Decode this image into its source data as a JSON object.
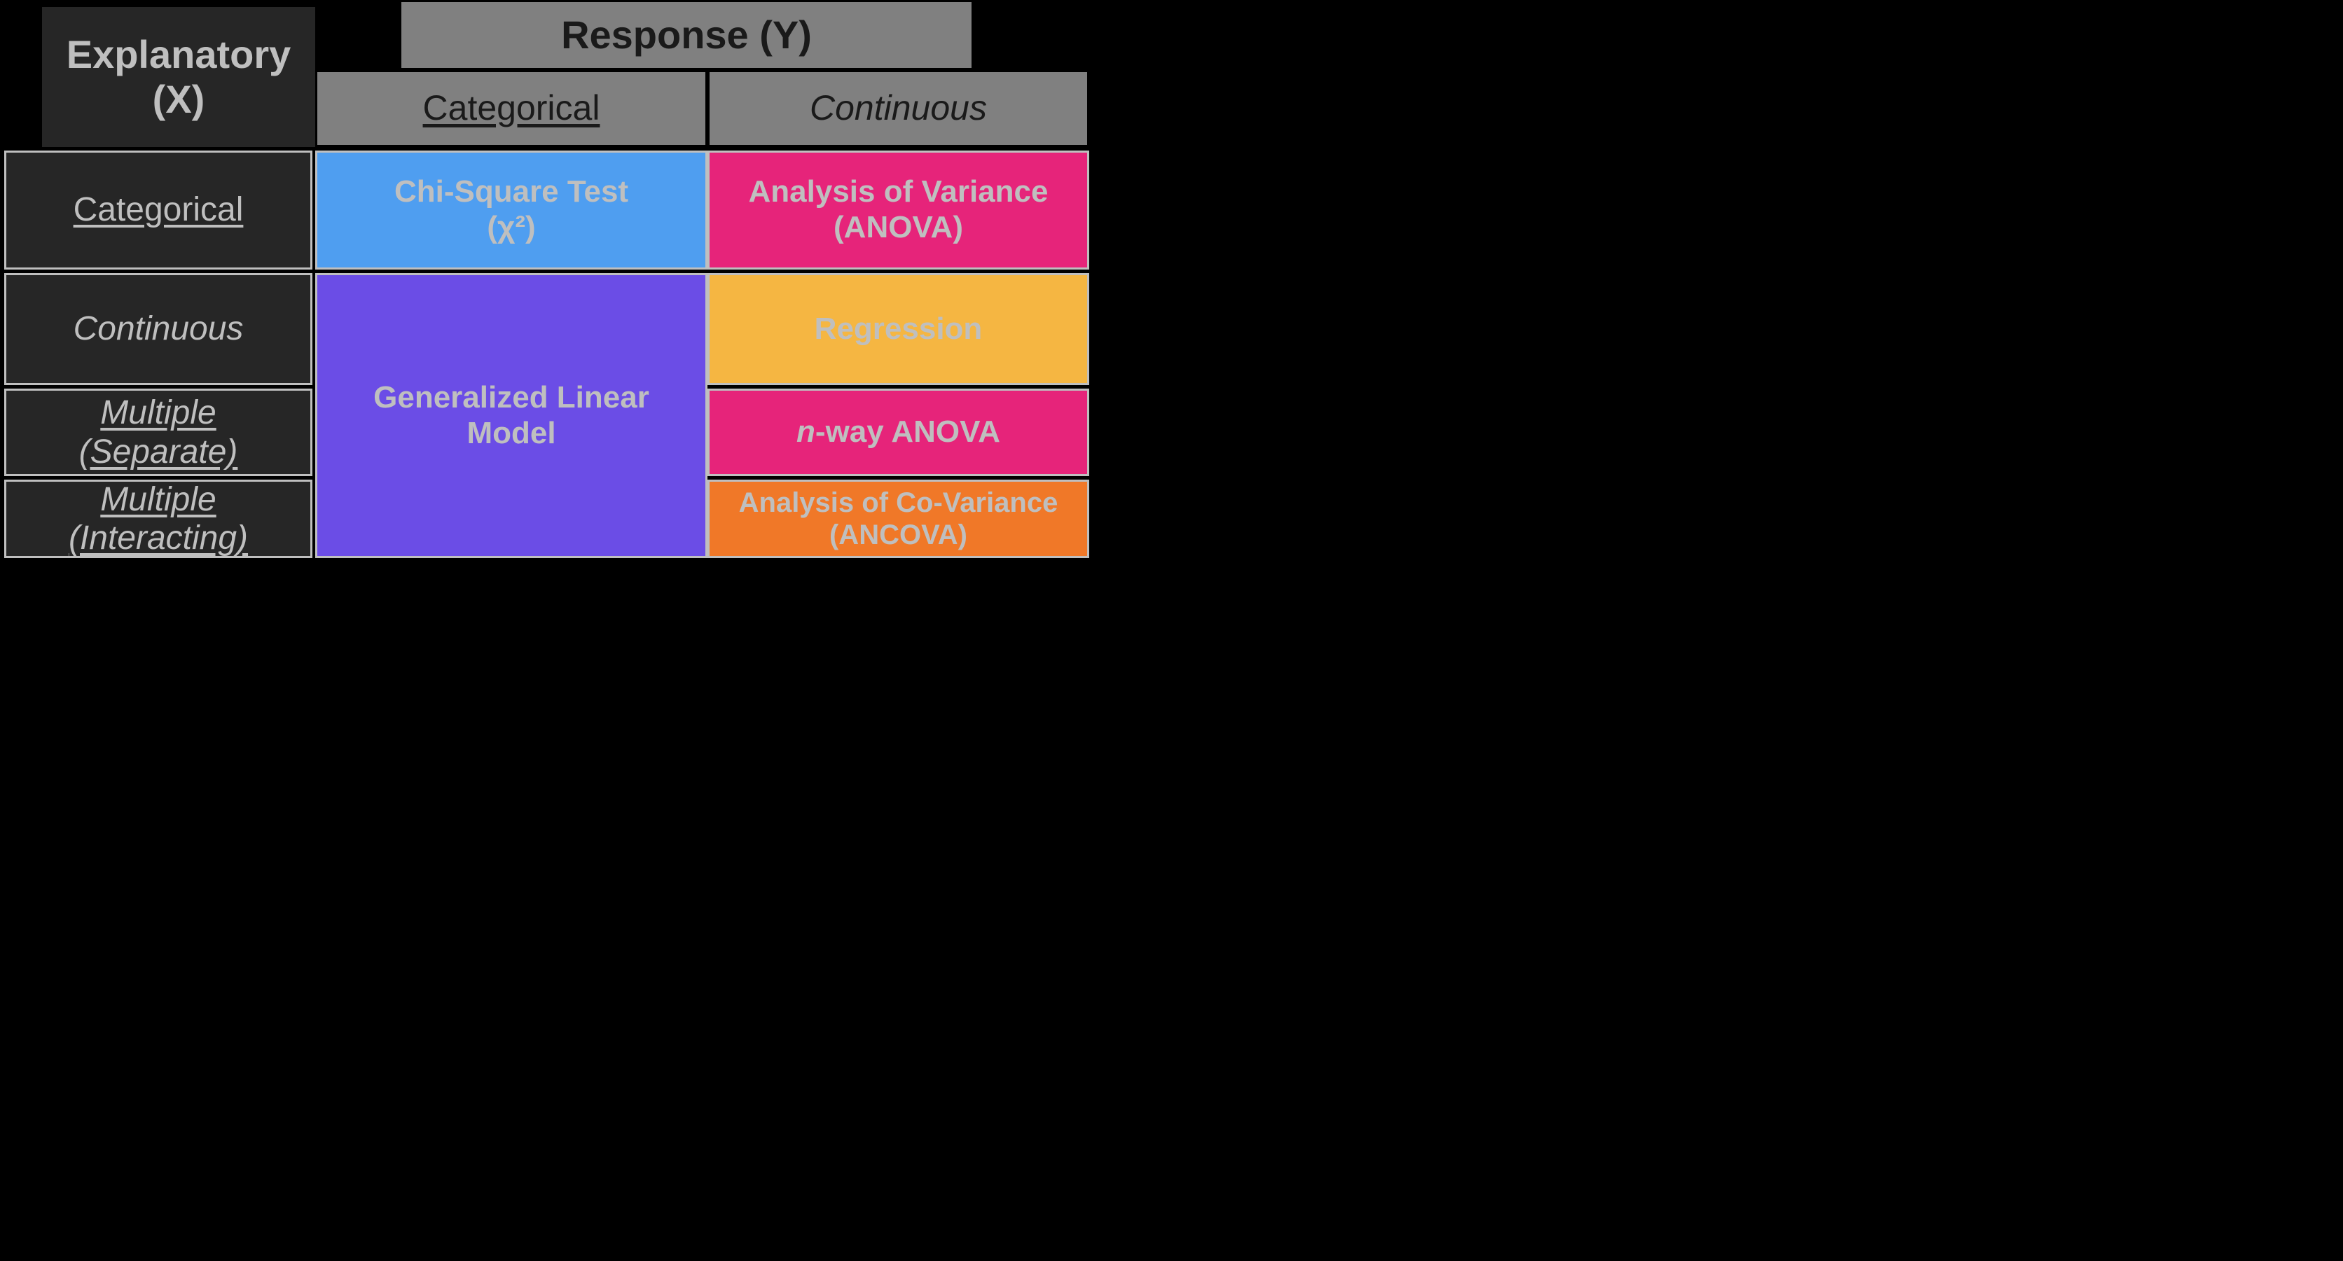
{
  "chart_data": {
    "type": "table",
    "title_rows": "Explanatory (X)",
    "title_cols": "Response (Y)",
    "col_headers": [
      "Categorical",
      "Continuous"
    ],
    "row_headers": [
      "Categorical",
      "Continuous",
      "Multiple (Separate)",
      "Multiple (Interacting)"
    ],
    "cells": [
      [
        "Chi-Square Test (χ²)",
        "Analysis of Variance (ANOVA)"
      ],
      [
        "Generalized Linear Model",
        "Regression"
      ],
      [
        "Generalized Linear Model",
        "n-way ANOVA"
      ],
      [
        "Generalized Linear Model",
        "Analysis of Co-Variance (ANCOVA)"
      ]
    ],
    "note": "Column 'Categorical' rows 2–4 are a single merged cell: Generalized Linear Model"
  },
  "headers": {
    "explanatory_line1": "Explanatory",
    "explanatory_line2": "(X)",
    "response": "Response (Y)",
    "col_categorical": "Categorical",
    "col_continuous": "Continuous"
  },
  "rows": {
    "r1": "Categorical",
    "r2": "Continuous",
    "r3_l1": "Multiple",
    "r3_l2": "(Separate)",
    "r4_l1": "Multiple",
    "r4_l2": "(Interacting)"
  },
  "cells": {
    "chisq_l1": "Chi-Square Test",
    "chisq_l2": "(χ²)",
    "anova_l1": "Analysis of Variance",
    "anova_l2": "(ANOVA)",
    "glm_l1": "Generalized Linear",
    "glm_l2": "Model",
    "regression": "Regression",
    "nway_n": "n",
    "nway_rest": "-way ANOVA",
    "ancova_l1": "Analysis of Co-Variance",
    "ancova_l2": "(ANCOVA)"
  },
  "colors": {
    "blue": "#4f9ef0",
    "magenta": "#e6247a",
    "purple": "#6b4de6",
    "yellow": "#f5b642",
    "orange": "#f07828",
    "dark": "#262626",
    "gray": "#808080",
    "text": "#bfbfbf"
  }
}
